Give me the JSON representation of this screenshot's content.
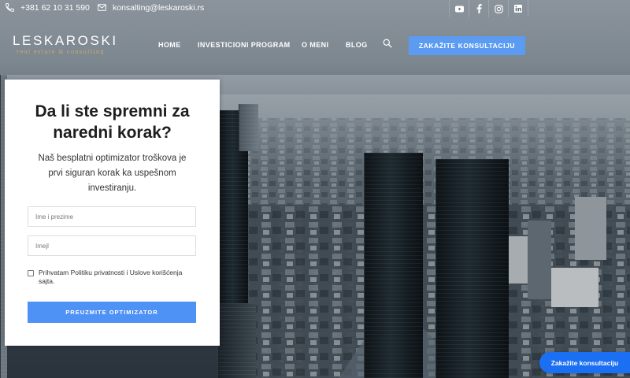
{
  "topbar": {
    "phone": "+381 62 10 31 590",
    "email": "konsalting@leskaroski.rs",
    "social_icons": [
      "youtube-icon",
      "facebook-icon",
      "instagram-icon",
      "linkedin-icon"
    ]
  },
  "header": {
    "logo_name": "LESKAROSKI",
    "logo_tagline": "real estate & consulting",
    "nav": [
      "HOME",
      "INVESTICIONI PROGRAM",
      "O MENI",
      "BLOG"
    ],
    "cta_label": "ZAKAŽITE KONSULTACIJU"
  },
  "form": {
    "title_line1": "Da li ste spremni za",
    "title_line2": "naredni korak?",
    "lead_line1": "Naš besplatni optimizator troškova je",
    "lead_line2": "prvi siguran korak ka uspešnom",
    "lead_line3": "investiranju.",
    "name_placeholder": "Ime i prezime",
    "email_placeholder": "Imejl",
    "consent_line1": "Prihvatam Politiku privatnosti i Uslove korišćenja",
    "consent_line2": "sajta.",
    "submit_label": "PREUZMITE OPTIMIZATOR"
  },
  "floating_button": {
    "label": "Zakažite konsultaciju"
  },
  "colors": {
    "accent": "#5b9cf2",
    "submit": "#4f92f5",
    "floating": "#1a6ff2",
    "logo_tagline": "#c8a870"
  }
}
